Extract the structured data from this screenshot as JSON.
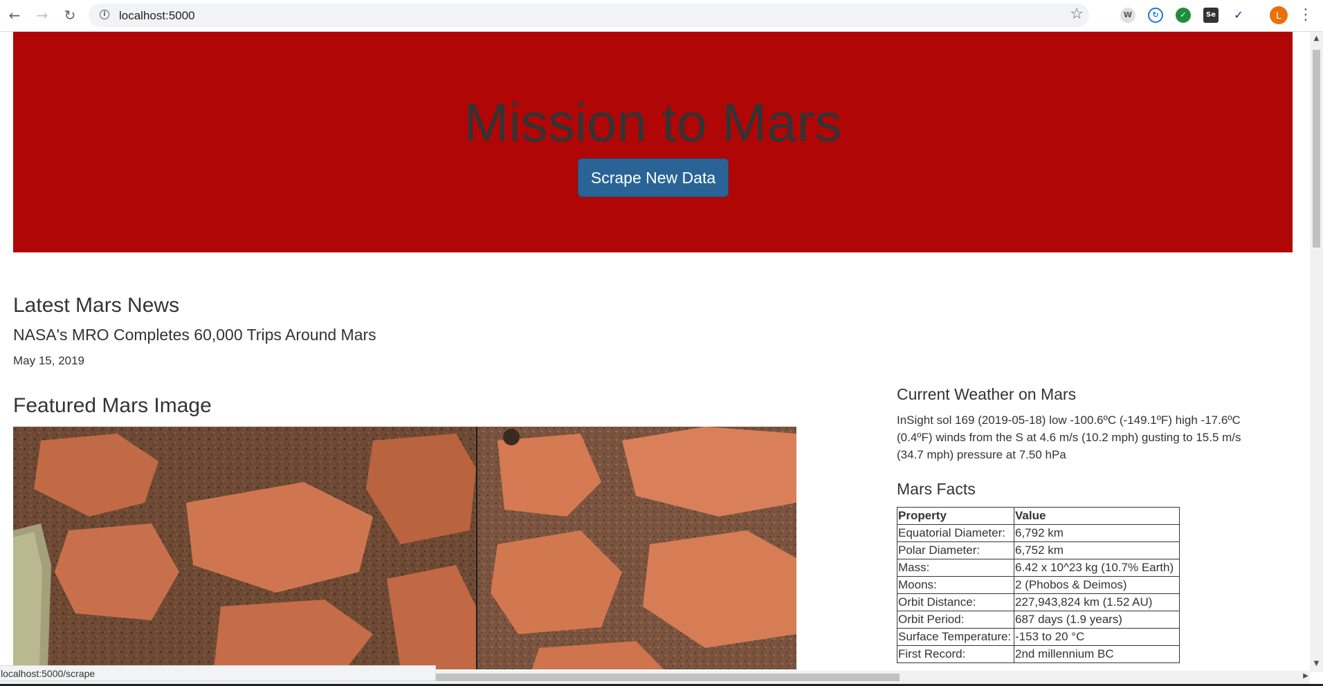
{
  "browser": {
    "url": "localhost:5000",
    "status_url": "localhost:5000/scrape",
    "profile_initial": "L",
    "extensions": [
      "W",
      "Se"
    ]
  },
  "header": {
    "title": "Mission to Mars",
    "button_label": "Scrape New Data"
  },
  "news": {
    "heading": "Latest Mars News",
    "title": "NASA's MRO Completes 60,000 Trips Around Mars",
    "date": "May 15, 2019"
  },
  "featured": {
    "heading": "Featured Mars Image"
  },
  "weather": {
    "heading": "Current Weather on Mars",
    "text": "InSight sol 169 (2019-05-18) low -100.6ºC (-149.1ºF) high -17.6ºC (0.4ºF) winds from the S at 4.6 m/s (10.2 mph) gusting to 15.5 m/s (34.7 mph) pressure at 7.50 hPa"
  },
  "facts": {
    "heading": "Mars Facts",
    "columns": [
      "Property",
      "Value"
    ],
    "rows": [
      [
        "Equatorial Diameter:",
        "6,792 km"
      ],
      [
        "Polar Diameter:",
        "6,752 km"
      ],
      [
        "Mass:",
        "6.42 x 10^23 kg (10.7% Earth)"
      ],
      [
        "Moons:",
        "2 (Phobos & Deimos)"
      ],
      [
        "Orbit Distance:",
        "227,943,824 km (1.52 AU)"
      ],
      [
        "Orbit Period:",
        "687 days (1.9 years)"
      ],
      [
        "Surface Temperature:",
        "-153 to 20 °C"
      ],
      [
        "First Record:",
        "2nd millennium BC"
      ]
    ]
  },
  "colors": {
    "jumbotron": "#b10606",
    "button": "#2a6496"
  }
}
